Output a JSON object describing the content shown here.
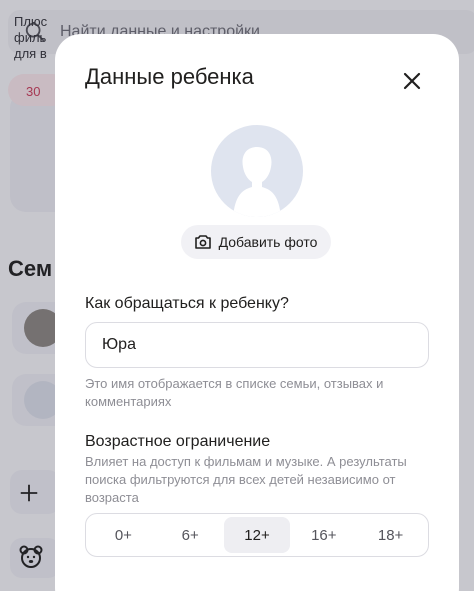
{
  "background": {
    "search": {
      "placeholder": "Найти данные и настройки",
      "icon": "search-icon"
    },
    "promo": {
      "text": "Плюс\nфиль\nдля в",
      "chip": "30"
    },
    "family_title": "Сем"
  },
  "modal": {
    "title": "Данные ребенка",
    "close_icon": "close-icon",
    "avatar_icon": "child-silhouette-icon",
    "add_photo_label": "Добавить фото",
    "name_label": "Как обращаться к ребенку?",
    "name_value": "Юра",
    "name_hint": "Это имя отображается в списке семьи, отзывах и комментариях",
    "age_label": "Возрастное ограничение",
    "age_desc": "Влияет на доступ к фильмам и музыке. А результаты поиска фильтруются для всех детей независимо от возраста",
    "age_options": [
      "0+",
      "6+",
      "12+",
      "16+",
      "18+"
    ],
    "age_selected": "12+"
  },
  "colors": {
    "modal_bg": "#ffffff",
    "avatar_bg": "#dfe4ef",
    "hint_text": "#8e8e95",
    "selected_segment": "#eeeef2",
    "promo_accent": "#c93d5a"
  }
}
